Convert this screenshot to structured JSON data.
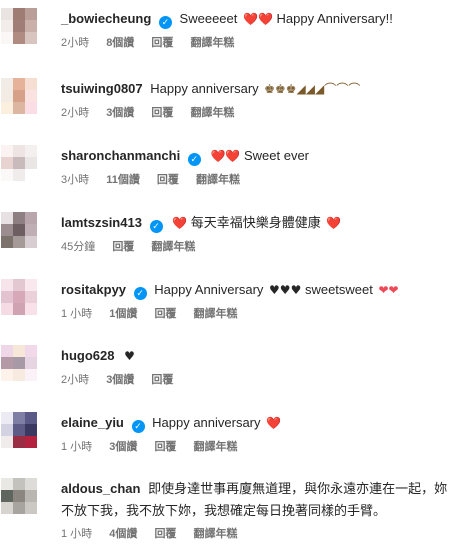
{
  "comments": [
    {
      "username": "_bowiecheung",
      "verified": true,
      "text": "Sweeeeet",
      "after_text": "Happy Anniversary!!",
      "emoji": "❤️❤️",
      "time": "2小時",
      "likes": "8個讚",
      "reply": "回覆",
      "translate": "翻譯年糕",
      "avatar_colors": [
        "#e9e4e2",
        "#9e7c74",
        "#b99f97",
        "#f2ecea",
        "#a07e77",
        "#c9b0a8",
        "#faf7f6",
        "#b08b82",
        "#d8c5bf"
      ]
    },
    {
      "username": "tsuiwing0807",
      "verified": false,
      "text": "Happy anniversary",
      "emoji": "♚♚♚◢◢◢⌒⌒⌒",
      "time": "2小時",
      "likes": "3個讚",
      "reply": "回覆",
      "translate": "翻譯年糕",
      "avatar_colors": [
        "#f2ece6",
        "#e6b39a",
        "#f6ded3",
        "#f3ece4",
        "#d7a088",
        "#f9e2e0",
        "#fbf0dd",
        "#ddb6a2",
        "#fbdde6"
      ]
    },
    {
      "username": "sharonchanmanchi",
      "verified": true,
      "text": "Sweet ever",
      "emoji": "❤️❤️",
      "time": "3小時",
      "likes": "11個讚",
      "reply": "回覆",
      "translate": "翻譯年糕",
      "avatar_colors": [
        "#fbf3f1",
        "#efe4e4",
        "#f4f0f0",
        "#e9d3d1",
        "#c9babb",
        "#ebe6e6",
        "#fbf8f8",
        "#f1ecec",
        "#ffffff"
      ]
    },
    {
      "username": "lamtszsin413",
      "verified": true,
      "text": "每天幸福快樂身體健康",
      "emoji": "❤️",
      "time": "45分鐘",
      "likes": "",
      "reply": "回覆",
      "translate": "翻譯年糕",
      "avatar_colors": [
        "#e7e1e4",
        "#8e7f83",
        "#b9a6ac",
        "#9b8c90",
        "#6d5e62",
        "#bfaeb3",
        "#7c726c",
        "#a69a98",
        "#d8cdd0"
      ]
    },
    {
      "username": "rositakpyy",
      "verified": true,
      "text": "Happy Anniversary",
      "after_text": "sweetsweet",
      "emoji": "♥♥♥",
      "time": "1 小時",
      "likes": "1個讚",
      "reply": "回覆",
      "translate": "翻譯年糕",
      "avatar_colors": [
        "#f6e4ea",
        "#e4c8d1",
        "#fae8ef",
        "#e3c3cf",
        "#d7a9b8",
        "#ebd0da",
        "#f5dce4",
        "#cfa3b1",
        "#f8e1e8"
      ]
    },
    {
      "username": "hugo628",
      "verified": false,
      "text": "",
      "emoji": "♥",
      "time": "2小時",
      "likes": "3個讚",
      "reply": "回覆",
      "translate": "",
      "avatar_colors": [
        "#f0d7e8",
        "#f6e7d8",
        "#f1d9e9",
        "#b49aa7",
        "#a899a7",
        "#e7d4e2",
        "#fdf3ea",
        "#f7eadf",
        "#fbf2f7"
      ]
    },
    {
      "username": "elaine_yiu",
      "verified": true,
      "text": "Happy anniversary",
      "emoji": "❤️",
      "time": "1 小時",
      "likes": "3個讚",
      "reply": "回覆",
      "translate": "翻譯年糕",
      "avatar_colors": [
        "#ecebf3",
        "#7f7fa6",
        "#5b5a86",
        "#d3d2e3",
        "#5e5b86",
        "#3b3862",
        "#f1ecec",
        "#9a2d44",
        "#b3233f"
      ]
    },
    {
      "username": "aldous_chan",
      "verified": false,
      "text": "即使身達世事再廈無道理，與你永遠亦連在一起，妳不放下我，我不放下妳，我想確定每日挽著同樣的手臂。",
      "emoji": "",
      "time": "1 小時",
      "likes": "4個讚",
      "reply": "回覆",
      "translate": "翻譯年糕",
      "avatar_colors": [
        "#e9e8e5",
        "#c3c2bd",
        "#dddcd9",
        "#5f6660",
        "#8b8680",
        "#b9b5b0",
        "#d7d4d0",
        "#a7a39e",
        "#cbc8c4"
      ]
    }
  ],
  "colors": {
    "heart": "#ed4956",
    "verified": "#0095f6",
    "meta": "#737373"
  },
  "icons": {
    "verified": "verified-badge-icon"
  }
}
